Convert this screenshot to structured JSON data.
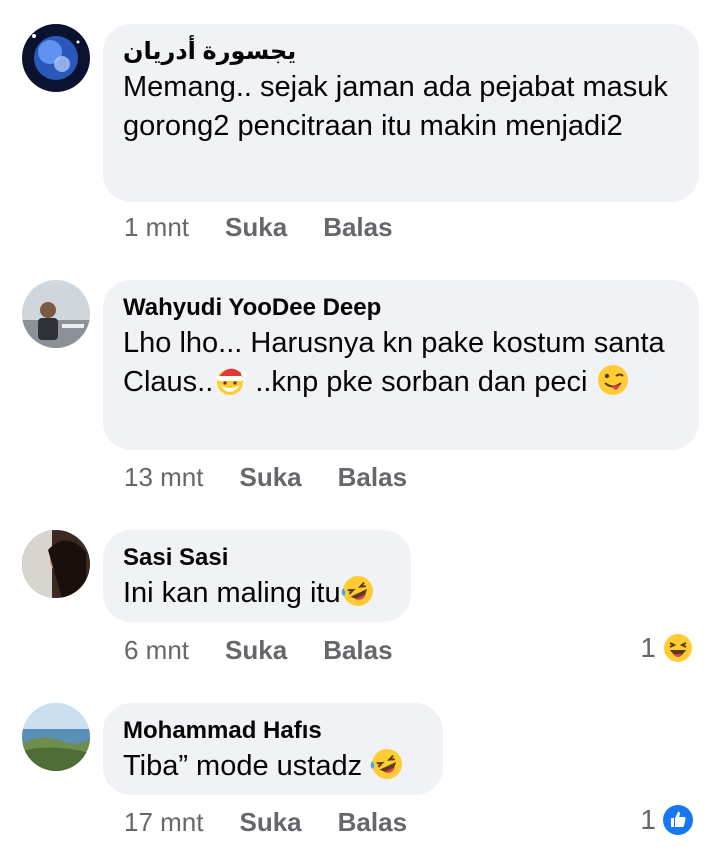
{
  "colors": {
    "bubble_bg": "#f0f2f5",
    "meta_text": "#65676b",
    "like_blue": "#1877f2",
    "emoji_yellow": "#ffcc33"
  },
  "comments": [
    {
      "author": "يجسورة أدريان",
      "text": "Memang.. sejak jaman ada pejabat masuk gorong2 pencitraan itu makin menjadi2",
      "time": "1 mnt",
      "like_label": "Suka",
      "reply_label": "Balas",
      "avatar_icon": "blue-planet-avatar"
    },
    {
      "author": "Wahyudi YooDee Deep",
      "text_part1": "Lho lho... Harusnya kn pake kostum santa Claus..",
      "text_part2": " ..knp pke sorban dan peci ",
      "emoji1": "santa-emoji",
      "emoji2": "winking-tongue-emoji",
      "time": "13 mnt",
      "like_label": "Suka",
      "reply_label": "Balas",
      "avatar_icon": "man-portrait-avatar"
    },
    {
      "author": "Sasi Sasi",
      "text": "Ini kan maling itu",
      "emoji": "rolling-laughing-emoji",
      "time": "6 mnt",
      "like_label": "Suka",
      "reply_label": "Balas",
      "reaction_count": "1",
      "reaction_icon": "laughing-reaction-icon",
      "avatar_icon": "dark-portrait-avatar"
    },
    {
      "author": "Mohammad Hafıs",
      "text": "Tiba” mode ustadz ",
      "emoji": "rolling-laughing-emoji",
      "time": "17 mnt",
      "like_label": "Suka",
      "reply_label": "Balas",
      "reaction_count": "1",
      "reaction_icon": "like-reaction-icon",
      "avatar_icon": "coast-landscape-avatar"
    }
  ]
}
